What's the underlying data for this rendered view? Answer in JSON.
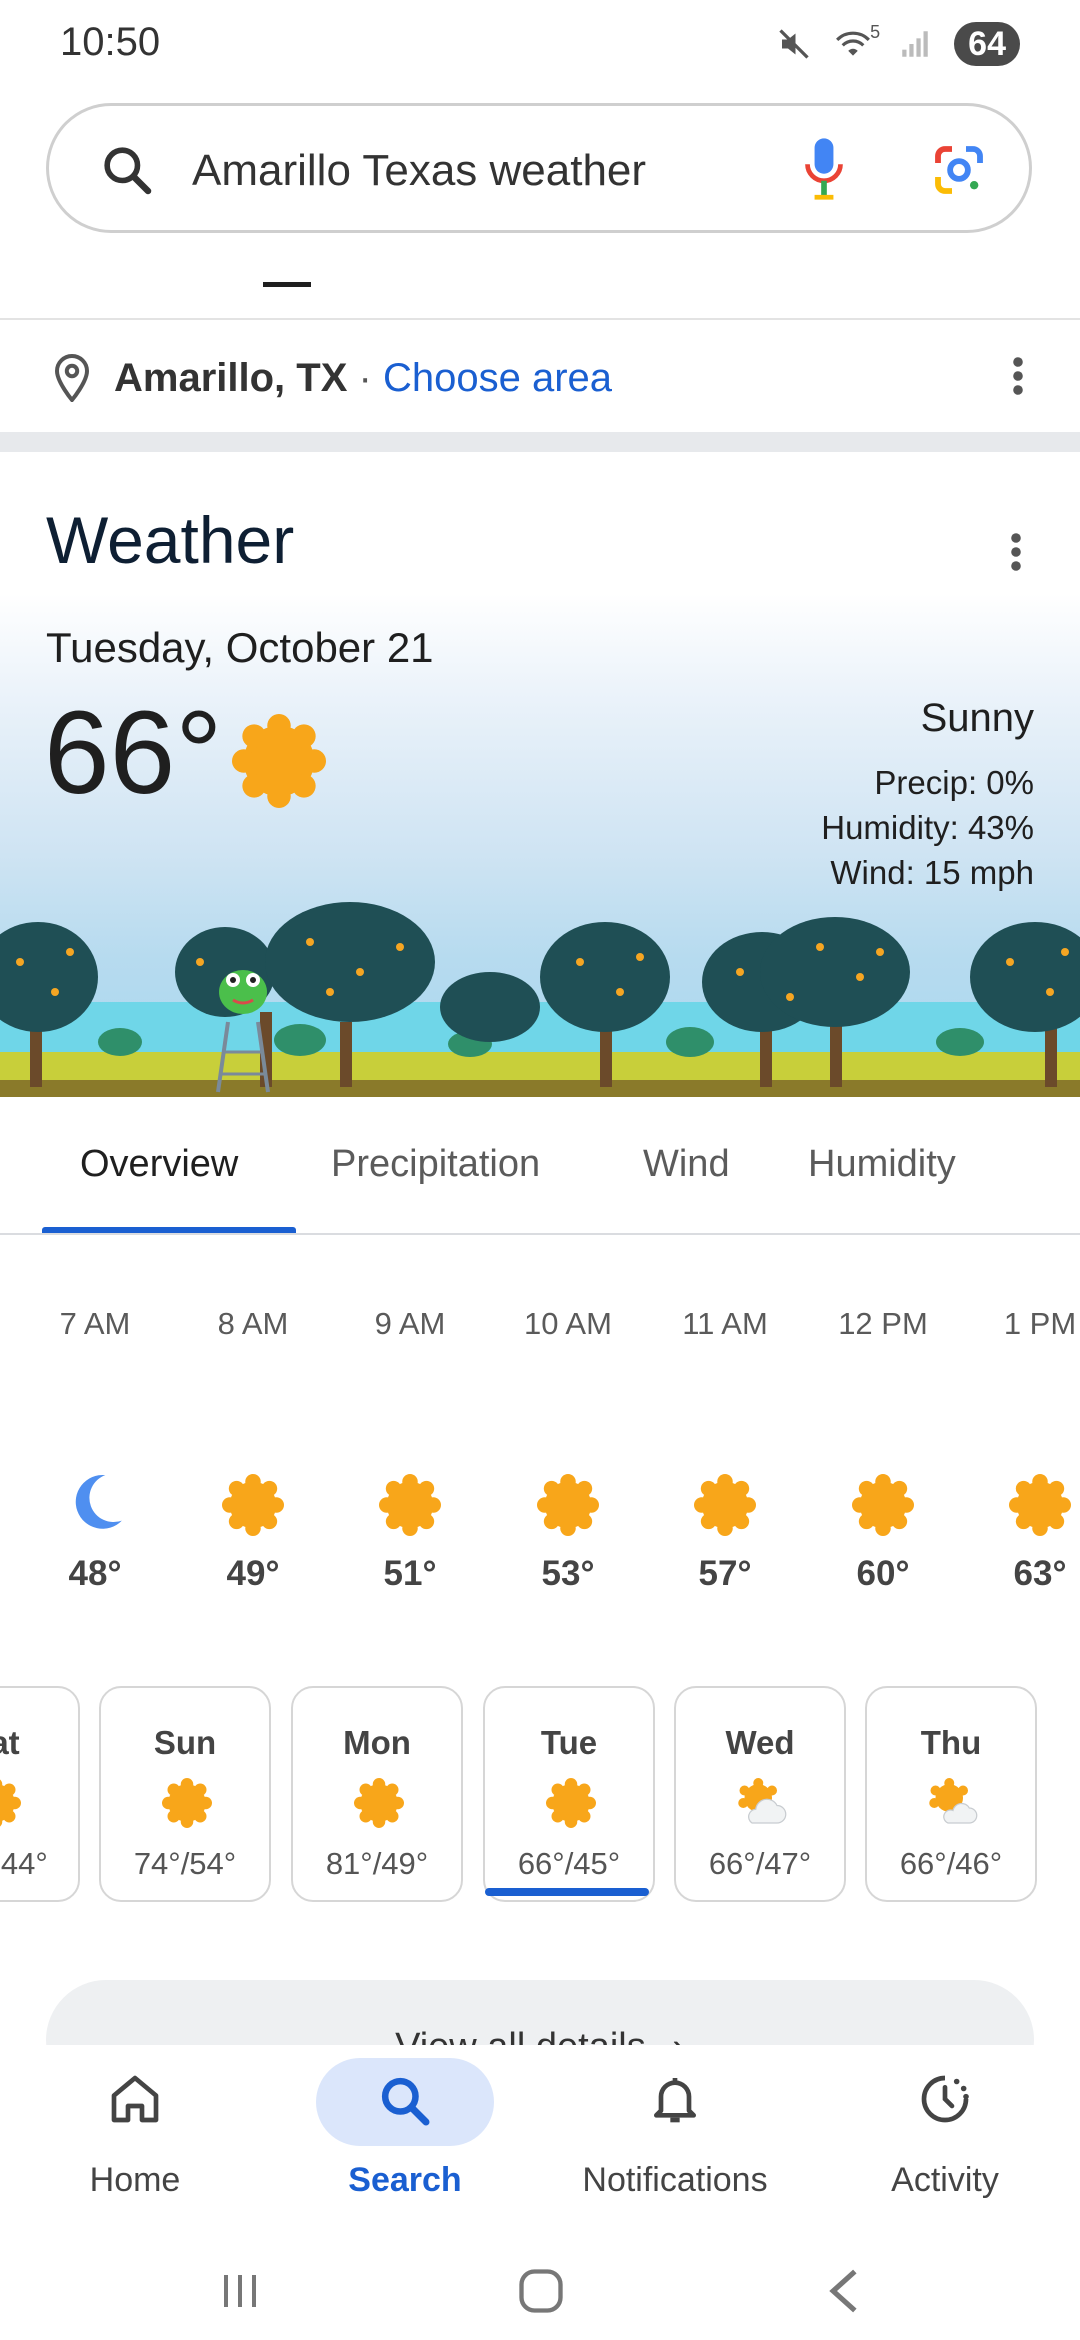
{
  "status_bar": {
    "time": "10:50",
    "wifi_badge": "5",
    "battery": "64"
  },
  "search": {
    "query": "Amarillo Texas weather"
  },
  "location": {
    "city": "Amarillo, TX",
    "separator": "·",
    "choose_area": "Choose area"
  },
  "weather": {
    "title": "Weather",
    "date": "Tuesday, October 21",
    "temperature": "66°",
    "condition": "Sunny",
    "precip": "Precip: 0%",
    "humidity": "Humidity: 43%",
    "wind": "Wind: 15 mph"
  },
  "tabs": [
    {
      "label": "Overview",
      "active": true
    },
    {
      "label": "Precipitation",
      "active": false
    },
    {
      "label": "Wind",
      "active": false
    },
    {
      "label": "Humidity",
      "active": false
    }
  ],
  "hourly": [
    {
      "time": "7 AM",
      "temp": "48°",
      "icon": "moon-icon"
    },
    {
      "time": "8 AM",
      "temp": "49°",
      "icon": "sun-icon"
    },
    {
      "time": "9 AM",
      "temp": "51°",
      "icon": "sun-icon"
    },
    {
      "time": "10 AM",
      "temp": "53°",
      "icon": "sun-icon"
    },
    {
      "time": "11 AM",
      "temp": "57°",
      "icon": "sun-icon"
    },
    {
      "time": "12 PM",
      "temp": "60°",
      "icon": "sun-icon"
    },
    {
      "time": "1 PM",
      "temp": "63°",
      "icon": "sun-icon"
    }
  ],
  "daily": [
    {
      "day": "Sat",
      "range": "44°",
      "icon": "sun-icon"
    },
    {
      "day": "Sun",
      "range": "74°/54°",
      "icon": "sun-icon"
    },
    {
      "day": "Mon",
      "range": "81°/49°",
      "icon": "sun-icon"
    },
    {
      "day": "Tue",
      "range": "66°/45°",
      "icon": "sun-icon",
      "selected": true
    },
    {
      "day": "Wed",
      "range": "66°/47°",
      "icon": "partly-cloudy-icon"
    },
    {
      "day": "Thu",
      "range": "66°/46°",
      "icon": "partly-cloudy-icon"
    }
  ],
  "view_all": {
    "label": "View all details",
    "chevron": "›"
  },
  "bottom_nav": [
    {
      "label": "Home",
      "icon": "home-icon"
    },
    {
      "label": "Search",
      "icon": "search-icon",
      "active": true
    },
    {
      "label": "Notifications",
      "icon": "bell-icon"
    },
    {
      "label": "Activity",
      "icon": "activity-icon"
    }
  ],
  "colors": {
    "accent": "#1a5fd1",
    "sun": "#f8a61a",
    "moon": "#4f8ff0"
  }
}
